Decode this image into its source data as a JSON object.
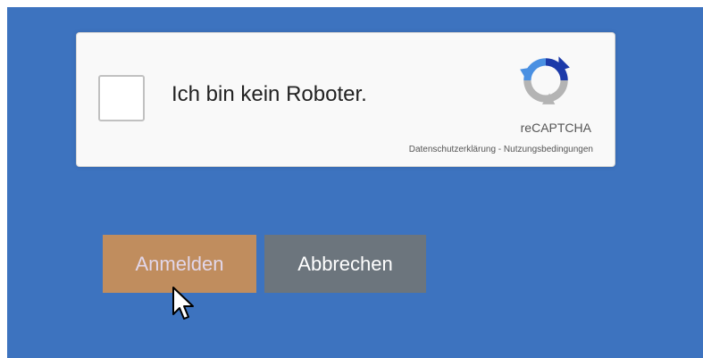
{
  "recaptcha": {
    "checkbox_label": "Ich bin kein Roboter.",
    "brand": "reCAPTCHA",
    "privacy_link": "Datenschutzerklärung",
    "separator": " - ",
    "terms_link": "Nutzungsbedingungen",
    "checked": false,
    "logo_icon": "recaptcha-logo-icon"
  },
  "buttons": {
    "login_label": "Anmelden",
    "cancel_label": "Abbrechen"
  },
  "colors": {
    "background": "#3d73bf",
    "login_button": "#c08d5e",
    "cancel_button": "#6c757d",
    "recaptcha_blue": "#4a90e2",
    "recaptcha_gray": "#b4b4b4",
    "recaptcha_dark_blue": "#1c3aa9"
  },
  "cursor_icon": "arrow-pointer-icon"
}
